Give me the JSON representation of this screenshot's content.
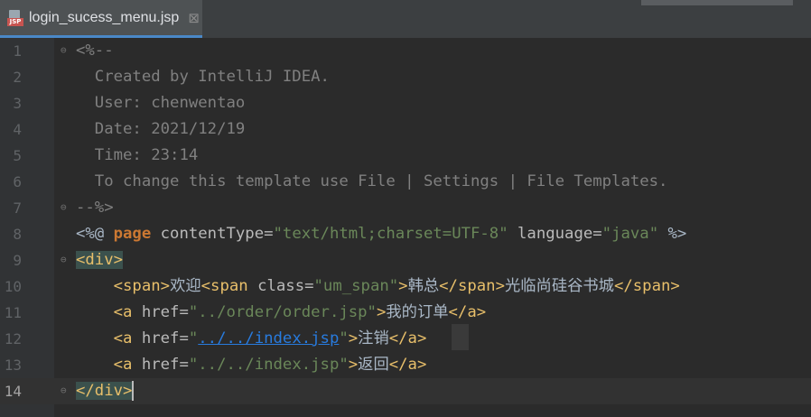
{
  "tab": {
    "icon_label": "JSP",
    "filename": "login_sucess_menu.jsp",
    "close": "⊠"
  },
  "editor": {
    "lines": [
      {
        "n": "1"
      },
      {
        "n": "2"
      },
      {
        "n": "3"
      },
      {
        "n": "4"
      },
      {
        "n": "5"
      },
      {
        "n": "6"
      },
      {
        "n": "7"
      },
      {
        "n": "8"
      },
      {
        "n": "9"
      },
      {
        "n": "10"
      },
      {
        "n": "11"
      },
      {
        "n": "12"
      },
      {
        "n": "13"
      },
      {
        "n": "14"
      }
    ],
    "comment_open": "<%--",
    "comment_created": "  Created by IntelliJ IDEA.",
    "comment_user": "  User: chenwentao",
    "comment_date": "  Date: 2021/12/19",
    "comment_time": "  Time: 23:14",
    "comment_change": "  To change this template use File | Settings | File Templates.",
    "comment_close": "--%>",
    "dir_open": "<%@ ",
    "dir_page": "page",
    "dir_ct_attr": " contentType=",
    "dir_ct_val": "\"text/html;charset=UTF-8\"",
    "dir_lang_attr": " language=",
    "dir_lang_val": "\"java\"",
    "dir_close": " %>",
    "div_open": "<div>",
    "l10_span_open": "<span>",
    "l10_text1": "欢迎",
    "l10_span2_open": "<span ",
    "l10_class_attr": "class=",
    "l10_class_val": "\"um_span\"",
    "l10_span2_close": ">",
    "l10_text2": "韩总",
    "l10_span_end": "</span>",
    "l10_text3": "光临尚硅谷书城",
    "l10_span_end2": "</span>",
    "l11_a": "<a ",
    "l11_href": "href=",
    "l11_href_val": "\"../order/order.jsp\"",
    "l11_gt": ">",
    "l11_text": "我的订单",
    "l11_end": "</a>",
    "l12_a": "<a ",
    "l12_href": "href=",
    "l12_q1": "\"",
    "l12_link": "../../index.jsp",
    "l12_q2": "\"",
    "l12_gt": ">",
    "l12_text": "注销",
    "l12_end": "</a>",
    "l13_a": "<a ",
    "l13_href": "href=",
    "l13_href_val": "\"../../index.jsp\"",
    "l13_gt": ">",
    "l13_text": "返回",
    "l13_end": "</a>",
    "div_close": "</div>"
  }
}
